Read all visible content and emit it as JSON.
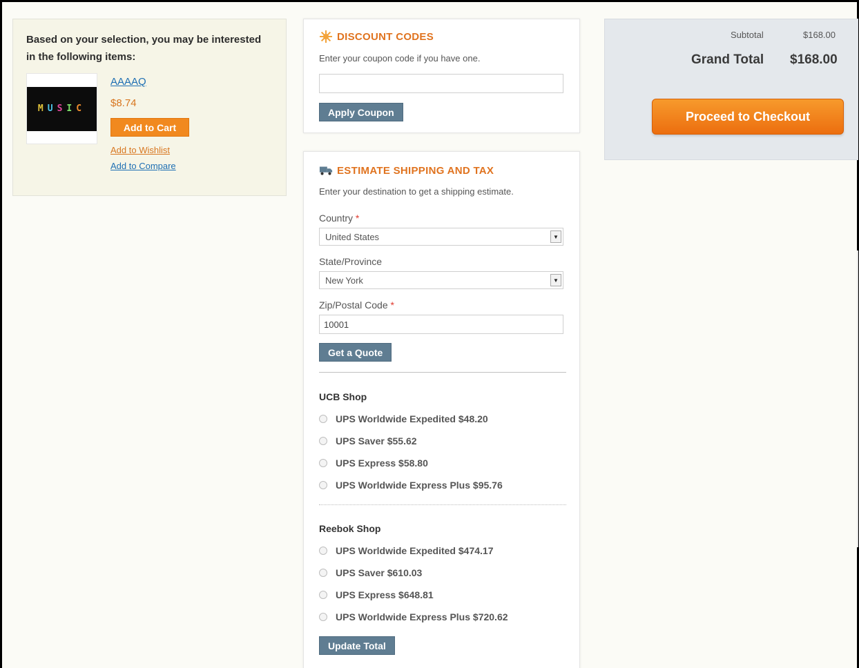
{
  "crosssell": {
    "title": "Based on your selection, you may be interested in the following items:",
    "product": {
      "image_text": "MUSIC",
      "name": "AAAAQ",
      "price": "$8.74",
      "add_to_cart": "Add to Cart",
      "add_to_wishlist": "Add to Wishlist",
      "add_to_compare": "Add to Compare"
    }
  },
  "discount": {
    "title": "DISCOUNT CODES",
    "icon": "discount-star-icon",
    "description": "Enter your coupon code if you have one.",
    "coupon_value": "",
    "apply_label": "Apply Coupon"
  },
  "shipping": {
    "title": "ESTIMATE SHIPPING AND TAX",
    "icon": "truck-icon",
    "description": "Enter your destination to get a shipping estimate.",
    "country_label": "Country",
    "country_value": "United States",
    "state_label": "State/Province",
    "state_value": "New York",
    "zip_label": "Zip/Postal Code",
    "zip_value": "10001",
    "required_mark": "*",
    "quote_label": "Get a Quote",
    "carriers": [
      {
        "name": "UCB Shop",
        "rates": [
          "UPS Worldwide Expedited $48.20",
          "UPS Saver $55.62",
          "UPS Express $58.80",
          "UPS Worldwide Express Plus $95.76"
        ]
      },
      {
        "name": "Reebok Shop",
        "rates": [
          "UPS Worldwide Expedited $474.17",
          "UPS Saver $610.03",
          "UPS Express $648.81",
          "UPS Worldwide Express Plus $720.62"
        ]
      }
    ],
    "update_label": "Update Total"
  },
  "totals": {
    "subtotal_label": "Subtotal",
    "subtotal_value": "$168.00",
    "grand_total_label": "Grand Total",
    "grand_total_value": "$168.00",
    "checkout_label": "Proceed to Checkout"
  },
  "colors": {
    "accent_orange": "#f1891f",
    "slate_button": "#5f7d92",
    "link_blue": "#1e6fb3"
  }
}
